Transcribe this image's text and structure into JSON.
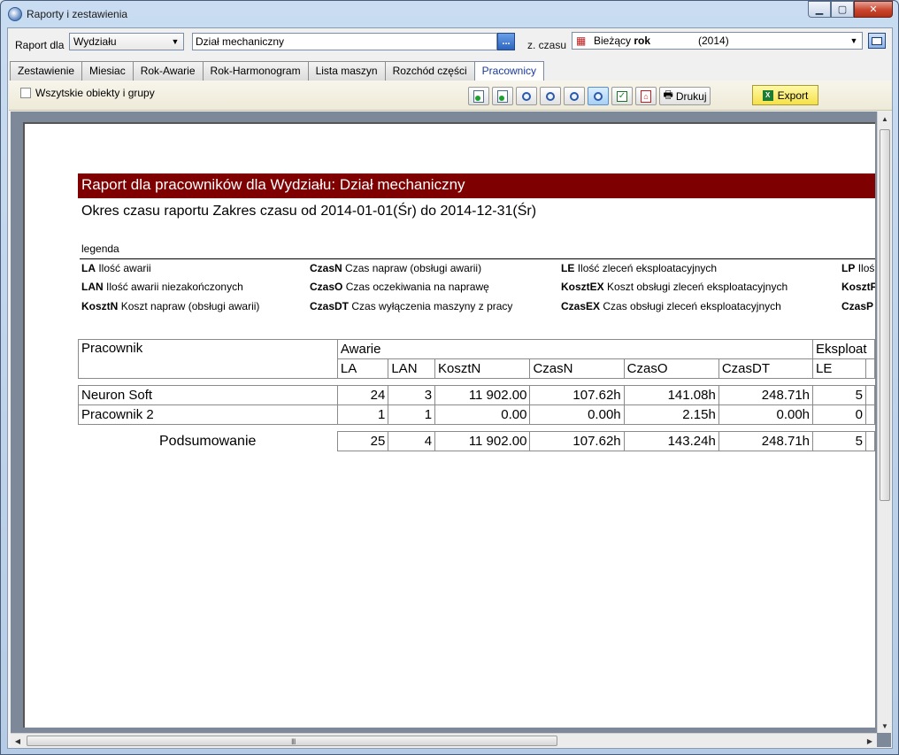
{
  "window": {
    "title": "Raporty i zestawienia"
  },
  "toolbar": {
    "report_for_label": "Raport dla",
    "dept_type": "Wydziału",
    "object_value": "Dział mechaniczny",
    "dots_label": "...",
    "time_label": "z. czasu",
    "time_range_prefix": "Bieżący",
    "time_range_unit": "rok",
    "time_range_year": "(2014)"
  },
  "tabs": [
    {
      "label": "Zestawienie"
    },
    {
      "label": "Miesiac"
    },
    {
      "label": "Rok-Awarie"
    },
    {
      "label": "Rok-Harmonogram"
    },
    {
      "label": "Lista maszyn"
    },
    {
      "label": "Rozchód części"
    },
    {
      "label": "Pracownicy"
    }
  ],
  "options": {
    "all_objects_label": "Wszytskie obiekty i grupy",
    "print_label": "Drukuj",
    "export_label": "Export"
  },
  "report": {
    "title": "Raport dla pracowników dla Wydziału: Dział mechaniczny",
    "period": "Okres czasu raportu Zakres czasu od 2014-01-01(Śr) do 2014-12-31(Śr)",
    "legend_label": "legenda",
    "legend": [
      {
        "code": "LA",
        "desc": "Ilość awarii"
      },
      {
        "code": "LAN",
        "desc": "Ilość awarii niezakończonych"
      },
      {
        "code": "KosztN",
        "desc": "Koszt napraw (obsługi awarii)"
      },
      {
        "code": "CzasN",
        "desc": "Czas napraw (obsługi awarii)"
      },
      {
        "code": "CzasO",
        "desc": "Czas oczekiwania na naprawę"
      },
      {
        "code": "CzasDT",
        "desc": "Czas wyłączenia maszyny z pracy"
      },
      {
        "code": "LE",
        "desc": "Ilość zleceń eksploatacyjnych"
      },
      {
        "code": "KosztEX",
        "desc": "Koszt obsługi zleceń eksploatacyjnych"
      },
      {
        "code": "CzasEX",
        "desc": "Czas obsługi zleceń eksploatacyjnych"
      },
      {
        "code": "LP",
        "desc": "Iloś"
      },
      {
        "code": "KosztF",
        "desc": ""
      },
      {
        "code": "CzasP",
        "desc": ""
      }
    ],
    "table": {
      "col_worker": "Pracownik",
      "group_awarie": "Awarie",
      "group_eksploat": "Eksploat",
      "headers": [
        "LA",
        "LAN",
        "KosztN",
        "CzasN",
        "CzasO",
        "CzasDT",
        "LE"
      ],
      "rows": [
        {
          "name": "Neuron Soft",
          "values": [
            "24",
            "3",
            "11 902.00",
            "107.62h",
            "141.08h",
            "248.71h",
            "5"
          ]
        },
        {
          "name": "Pracownik 2",
          "values": [
            "1",
            "1",
            "0.00",
            "0.00h",
            "2.15h",
            "0.00h",
            "0"
          ]
        }
      ],
      "summary_label": "Podsumowanie",
      "summary": [
        "25",
        "4",
        "11 902.00",
        "107.62h",
        "143.24h",
        "248.71h",
        "5"
      ]
    }
  }
}
